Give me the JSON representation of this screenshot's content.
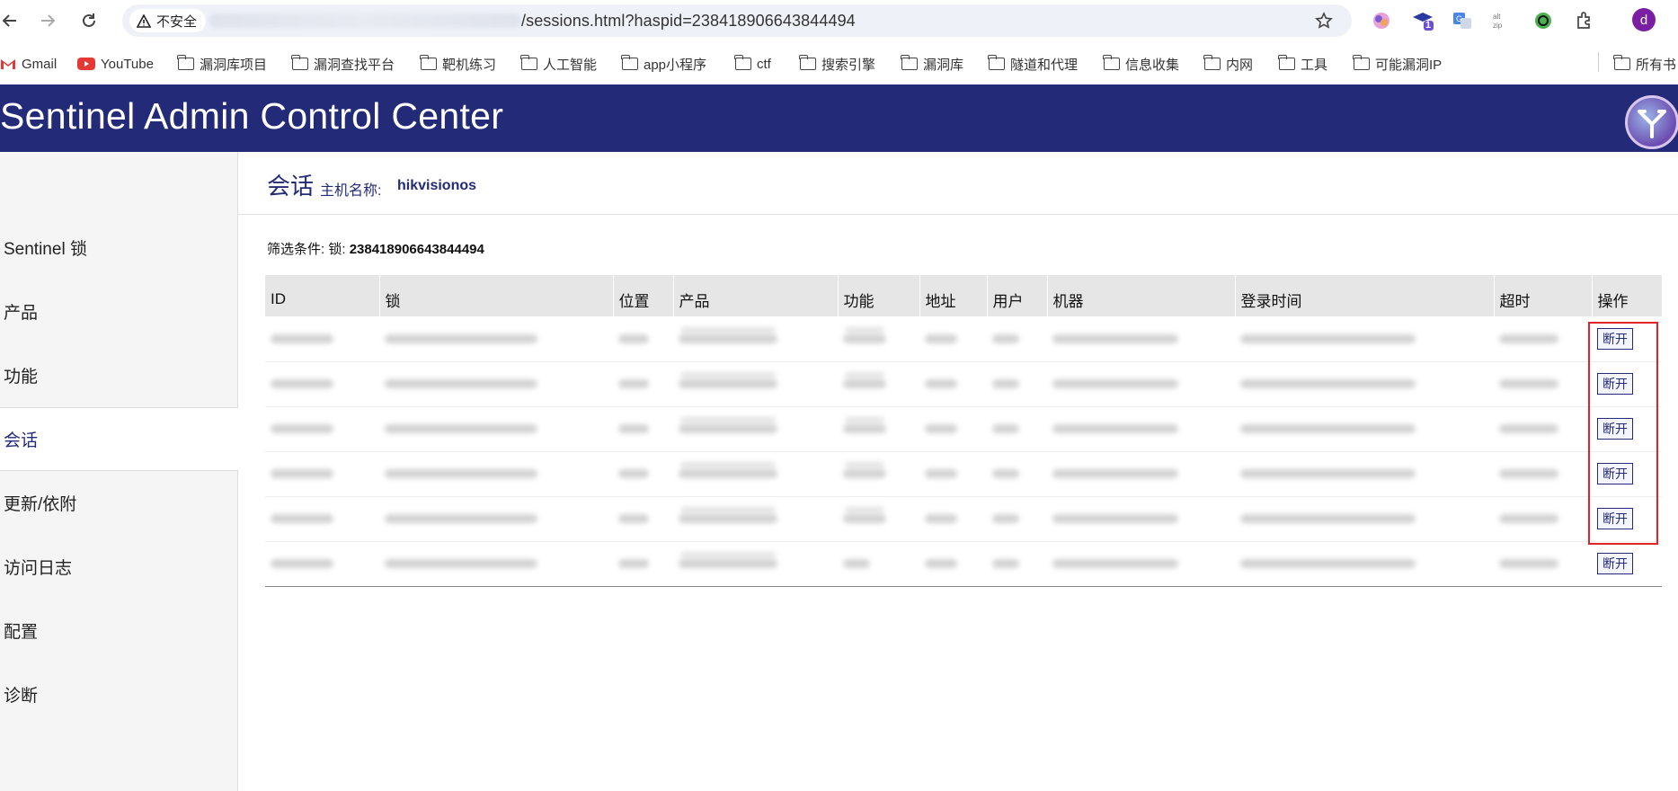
{
  "browser": {
    "security_label": "不安全",
    "url_visible": "/sessions.html?haspid=238418906643844494",
    "extension_badge": "1",
    "profile_initial": "d"
  },
  "bookmarks": [
    {
      "label": "Gmail",
      "icon": "gmail-icon"
    },
    {
      "label": "YouTube",
      "icon": "youtube-icon"
    },
    {
      "label": "漏洞库项目",
      "icon": "folder-icon"
    },
    {
      "label": "漏洞查找平台",
      "icon": "folder-icon"
    },
    {
      "label": "靶机练习",
      "icon": "folder-icon"
    },
    {
      "label": "人工智能",
      "icon": "folder-icon"
    },
    {
      "label": "app小程序",
      "icon": "folder-icon"
    },
    {
      "label": "ctf",
      "icon": "folder-icon"
    },
    {
      "label": "搜索引擎",
      "icon": "folder-icon"
    },
    {
      "label": "漏洞库",
      "icon": "folder-icon"
    },
    {
      "label": "隧道和代理",
      "icon": "folder-icon"
    },
    {
      "label": "信息收集",
      "icon": "folder-icon"
    },
    {
      "label": "内网",
      "icon": "folder-icon"
    },
    {
      "label": "工具",
      "icon": "folder-icon"
    },
    {
      "label": "可能漏洞IP",
      "icon": "folder-icon"
    },
    {
      "label": "所有书",
      "icon": "folder-icon"
    }
  ],
  "app": {
    "title_light": "Sentinel",
    "title_bold": "Admin Control Center",
    "header_color": "#232a78"
  },
  "sidebar": {
    "items": [
      {
        "label": "Sentinel 锁"
      },
      {
        "label": "产品"
      },
      {
        "label": "功能"
      },
      {
        "label": "会话",
        "active": true
      },
      {
        "label": "更新/依附"
      },
      {
        "label": "访问日志"
      },
      {
        "label": "配置"
      },
      {
        "label": "诊断"
      }
    ]
  },
  "page": {
    "title": "会话",
    "host_label": "主机名称:",
    "host_value": "hikvisionos",
    "filter_label": "筛选条件: 锁:",
    "filter_value": "238418906643844494"
  },
  "table": {
    "columns": [
      "ID",
      "锁",
      "位置",
      "产品",
      "功能",
      "地址",
      "用户",
      "机器",
      "登录时间",
      "超时",
      "操作"
    ],
    "action_label": "断开",
    "row_count": 6
  },
  "colors": {
    "accent": "#232a78",
    "highlight_box": "#e0242a"
  }
}
